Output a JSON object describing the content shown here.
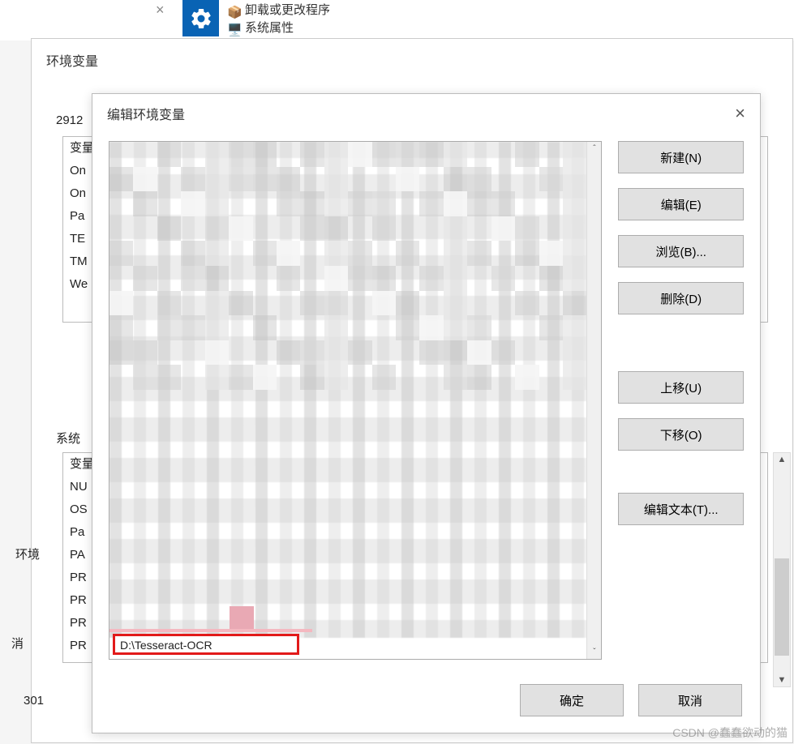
{
  "background": {
    "link1": "卸载或更改程序",
    "link2": "系统属性"
  },
  "env_dialog": {
    "title": "环境变量",
    "user_section_prefix": "2912",
    "user_vars": [
      "变量",
      "On",
      "On",
      "Pa",
      "TE",
      "TM",
      "We"
    ],
    "system_label": "系统",
    "system_vars": [
      "变量",
      "NU",
      "OS",
      "Pa",
      "PA",
      "PR",
      "PR",
      "PR",
      "PR"
    ],
    "side_label": "环境",
    "cancel_partial": "消",
    "num_301": "301"
  },
  "edit_dialog": {
    "title": "编辑环境变量",
    "selected_path": "D:\\Tesseract-OCR",
    "buttons": {
      "new": "新建(N)",
      "edit": "编辑(E)",
      "browse": "浏览(B)...",
      "delete": "删除(D)",
      "move_up": "上移(U)",
      "move_down": "下移(O)",
      "edit_text": "编辑文本(T)...",
      "ok": "确定",
      "cancel": "取消"
    }
  },
  "watermark": "CSDN @蠢蠢欲动的猫"
}
